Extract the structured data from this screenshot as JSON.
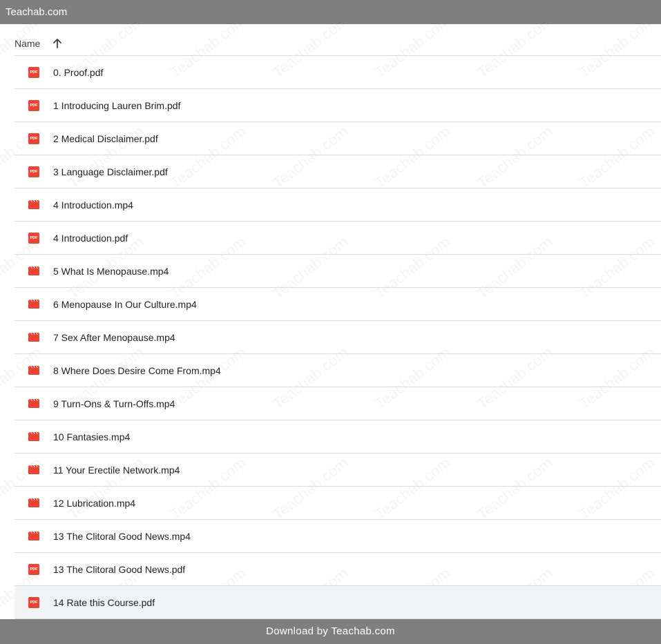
{
  "topbar": {
    "title": "Teachab.com"
  },
  "header": {
    "name_label": "Name",
    "sort_icon": "arrow-up-icon"
  },
  "files": [
    {
      "name": "0. Proof.pdf",
      "type": "pdf"
    },
    {
      "name": "1 Introducing Lauren Brim.pdf",
      "type": "pdf"
    },
    {
      "name": "2 Medical Disclaimer.pdf",
      "type": "pdf"
    },
    {
      "name": "3 Language Disclaimer.pdf",
      "type": "pdf"
    },
    {
      "name": "4 Introduction.mp4",
      "type": "video"
    },
    {
      "name": "4 Introduction.pdf",
      "type": "pdf"
    },
    {
      "name": "5 What Is Menopause.mp4",
      "type": "video"
    },
    {
      "name": "6 Menopause In Our Culture.mp4",
      "type": "video"
    },
    {
      "name": "7 Sex After Menopause.mp4",
      "type": "video"
    },
    {
      "name": "8 Where Does Desire Come From.mp4",
      "type": "video"
    },
    {
      "name": "9 Turn-Ons & Turn-Offs.mp4",
      "type": "video"
    },
    {
      "name": "10 Fantasies.mp4",
      "type": "video"
    },
    {
      "name": "11 Your Erectile Network.mp4",
      "type": "video"
    },
    {
      "name": "12 Lubrication.mp4",
      "type": "video"
    },
    {
      "name": "13 The Clitoral Good News.mp4",
      "type": "video"
    },
    {
      "name": "13 The Clitoral Good News.pdf",
      "type": "pdf"
    },
    {
      "name": "14 Rate this Course.pdf",
      "type": "pdf",
      "selected": true
    }
  ],
  "pdf_badge_text": "PDF",
  "colors": {
    "bar": "#7f7f7f",
    "icon_red": "#ea4335",
    "divider": "#dadce0",
    "selected_row": "#f1f3f4"
  },
  "watermark_text": "Teachab.com",
  "footer": {
    "text": "Download by Teachab.com"
  }
}
